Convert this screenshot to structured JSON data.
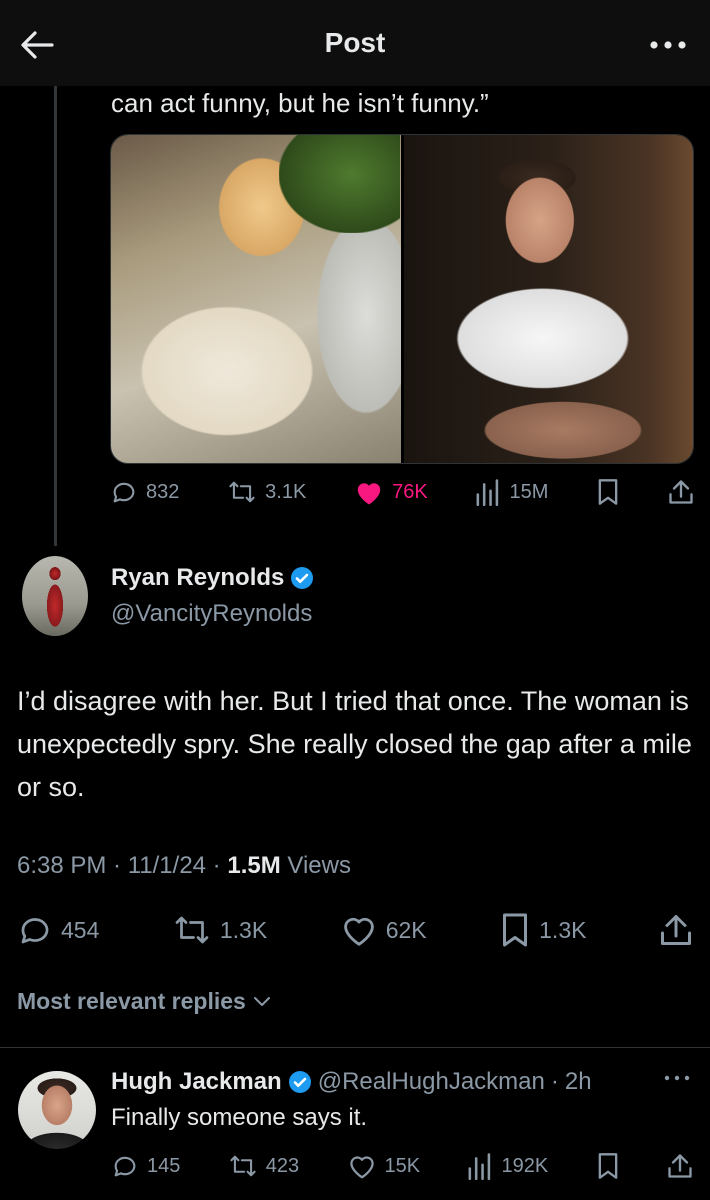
{
  "header": {
    "title": "Post"
  },
  "quoted": {
    "text_tail": "can act funny, but he isn’t funny.”",
    "stats": {
      "replies": "832",
      "reposts": "3.1K",
      "likes": "76K",
      "views": "15M"
    }
  },
  "post": {
    "author_name": "Ryan Reynolds",
    "author_handle": "@VancityReynolds",
    "text": "I’d disagree with her. But I tried that once. The woman is unexpectedly spry. She really closed the gap after a mile or so.",
    "time": "6:38 PM",
    "date": "11/1/24",
    "views_count": "1.5M",
    "views_label": "Views",
    "stats": {
      "replies": "454",
      "reposts": "1.3K",
      "likes": "62K",
      "bookmarks": "1.3K"
    }
  },
  "replies_filter": {
    "label": "Most relevant replies"
  },
  "reply": {
    "author_name": "Hugh Jackman",
    "author_handle": "@RealHughJackman",
    "age": "2h",
    "text": "Finally someone says it.",
    "stats": {
      "replies": "145",
      "reposts": "423",
      "likes": "15K",
      "views": "192K"
    }
  },
  "colors": {
    "background": "#000000",
    "text": "#e7e9ea",
    "muted": "#8b98a5",
    "like_active": "#f91880",
    "verified": "#1d9bf0"
  }
}
